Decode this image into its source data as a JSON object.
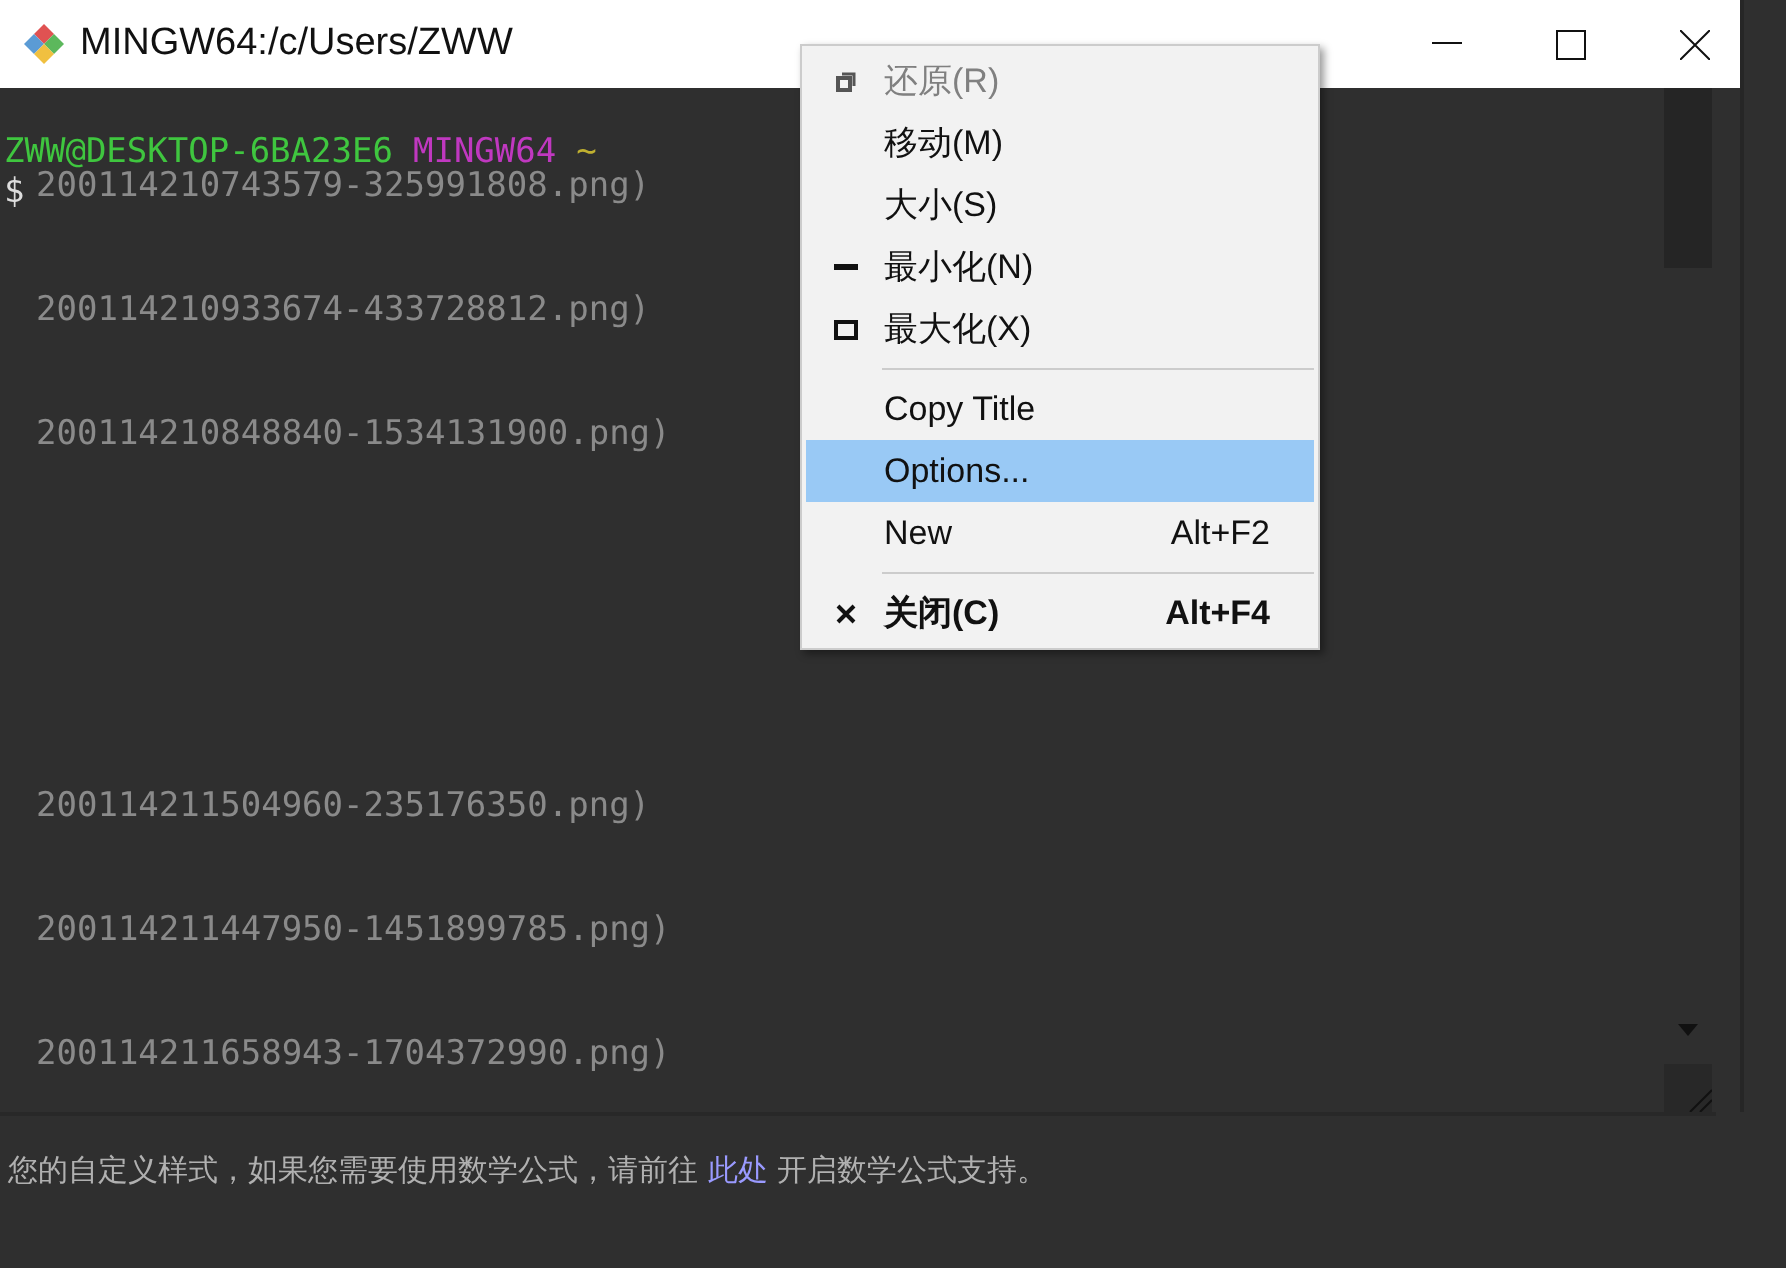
{
  "window": {
    "title": "MINGW64:/c/Users/ZWW"
  },
  "terminal": {
    "prompt_user": "ZWW@DESKTOP-6BA23E6",
    "prompt_system": "MINGW64",
    "prompt_dir": "~",
    "cursor_line": "$"
  },
  "background_lines": [
    "200114210743579-325991808.png)",
    "200114210933674-433728812.png)",
    "200114210848840-1534131900.png)",
    "200114211504960-235176350.png)",
    "200114211447950-1451899785.png)",
    "200114211658943-1704372990.png)"
  ],
  "context_menu": {
    "items": [
      {
        "kind": "restore",
        "label": "还原(R)",
        "disabled": true,
        "selected": false,
        "bold": false
      },
      {
        "kind": "item",
        "label": "移动(M)",
        "disabled": false,
        "selected": false,
        "bold": false
      },
      {
        "kind": "item",
        "label": "大小(S)",
        "disabled": false,
        "selected": false,
        "bold": false
      },
      {
        "kind": "minimize",
        "label": "最小化(N)",
        "disabled": false,
        "selected": false,
        "bold": false
      },
      {
        "kind": "maximize",
        "label": "最大化(X)",
        "disabled": false,
        "selected": false,
        "bold": false
      },
      {
        "kind": "separator"
      },
      {
        "kind": "item",
        "label": "Copy Title",
        "disabled": false,
        "selected": false,
        "bold": false
      },
      {
        "kind": "item",
        "label": "Options...",
        "disabled": false,
        "selected": true,
        "bold": false
      },
      {
        "kind": "item",
        "label": "New",
        "shortcut": "Alt+F2",
        "disabled": false,
        "selected": false,
        "bold": false
      },
      {
        "kind": "separator"
      },
      {
        "kind": "close",
        "label": "关闭(C)",
        "shortcut": "Alt+F4",
        "disabled": false,
        "selected": false,
        "bold": true
      }
    ]
  },
  "footer": {
    "text_before": "您的自定义样式，如果您需要使用数学公式，请前往",
    "link": "此处",
    "text_after": "开启数学公式支持。"
  }
}
